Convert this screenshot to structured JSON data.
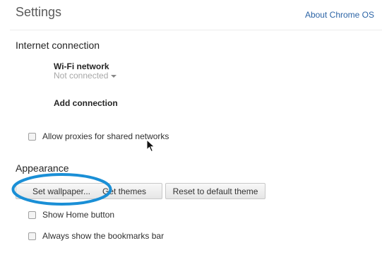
{
  "header": {
    "title": "Settings",
    "about_link": "About Chrome OS"
  },
  "internet": {
    "heading": "Internet connection",
    "network_title": "Wi-Fi network",
    "network_status": "Not connected",
    "add_connection": "Add connection",
    "proxies_label": "Allow proxies for shared networks",
    "proxies_checked": false
  },
  "appearance": {
    "heading": "Appearance",
    "set_wallpaper": "Set wallpaper...",
    "get_themes": "Get themes",
    "reset_theme": "Reset to default theme",
    "show_home_label": "Show Home button",
    "show_home_checked": false,
    "bookmarks_label": "Always show the bookmarks bar",
    "bookmarks_checked": false
  },
  "annotation": {
    "highlight_color": "#1a8fd6"
  },
  "icons": [
    "caret-down-icon",
    "mouse-pointer-icon",
    "checkbox-icon"
  ]
}
